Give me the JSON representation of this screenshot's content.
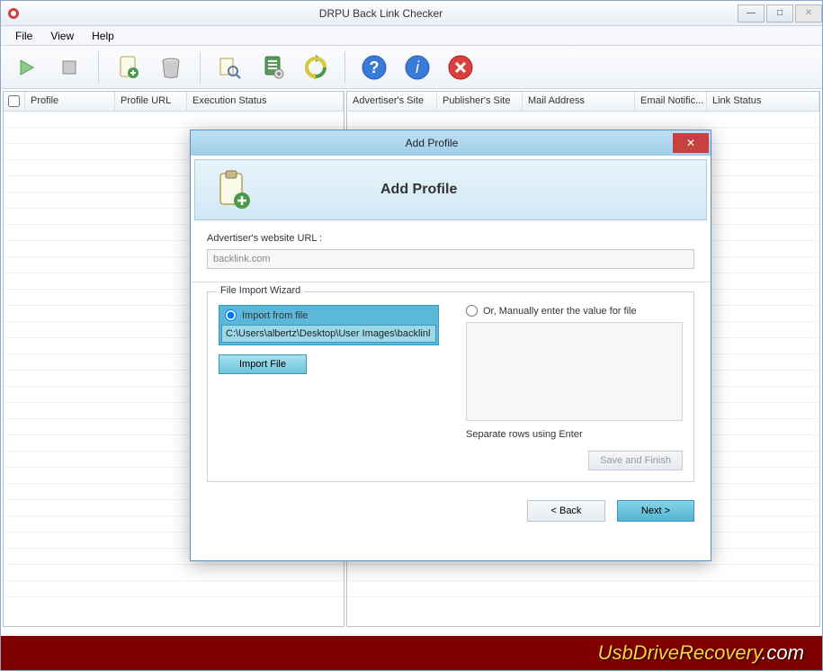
{
  "window": {
    "title": "DRPU Back Link Checker"
  },
  "menu": {
    "file": "File",
    "view": "View",
    "help": "Help"
  },
  "grid_left": {
    "cols": {
      "profile": "Profile",
      "url": "Profile URL",
      "status": "Execution Status"
    }
  },
  "grid_right": {
    "cols": {
      "adv": "Advertiser's Site",
      "pub": "Publisher's Site",
      "mail": "Mail Address",
      "email": "Email Notific...",
      "link": "Link Status"
    }
  },
  "dialog": {
    "title": "Add Profile",
    "header_title": "Add Profile",
    "url_label": "Advertiser's website URL :",
    "url_value": "backlink.com",
    "fieldset_legend": "File Import Wizard",
    "radio_import": "Import from file",
    "path_value": "C:\\Users\\albertz\\Desktop\\User Images\\backlinl",
    "import_file_btn": "Import File",
    "radio_manual": "Or, Manually enter the value for file",
    "sep_hint": "Separate rows using Enter",
    "save_finish": "Save and Finish",
    "back": "< Back",
    "next": "Next >"
  },
  "footer": {
    "brand_pre": "UsbDriveRecovery",
    "brand_suf": ".com"
  }
}
